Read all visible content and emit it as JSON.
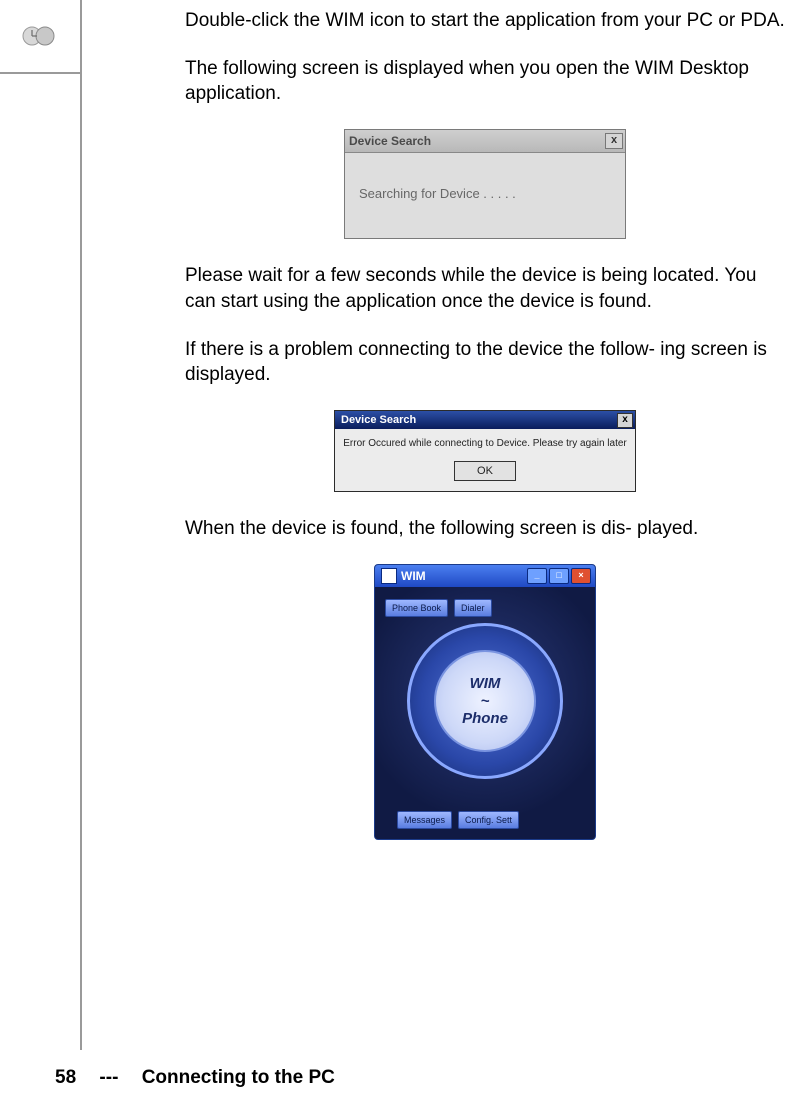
{
  "para1": "Double-click the WIM icon to start the application from your PC or PDA.",
  "para2": "The following screen is displayed when you open the WIM Desktop application.",
  "dlg1": {
    "title": "Device Search",
    "body": "Searching for Device . . . . ."
  },
  "para3": "Please wait for a few seconds while the device is being located. You can start using the application once the device is found.",
  "para4": "If there is a problem connecting to the device the follow- ing screen is displayed.",
  "dlg2": {
    "title": "Device Search",
    "msg": "Error Occured while connecting to Device. Please try again later",
    "ok": "OK"
  },
  "para5": "When the device is found, the following screen is dis- played.",
  "wim": {
    "title": "WIM",
    "tab_phonebook": "Phone Book",
    "tab_dialer": "Dialer",
    "center1": "WIM",
    "center2": "~",
    "center3": "Phone",
    "tab_messages": "Messages",
    "tab_config": "Config. Sett"
  },
  "footer": {
    "page": "58",
    "sep": "---",
    "title": "Connecting to the PC"
  }
}
